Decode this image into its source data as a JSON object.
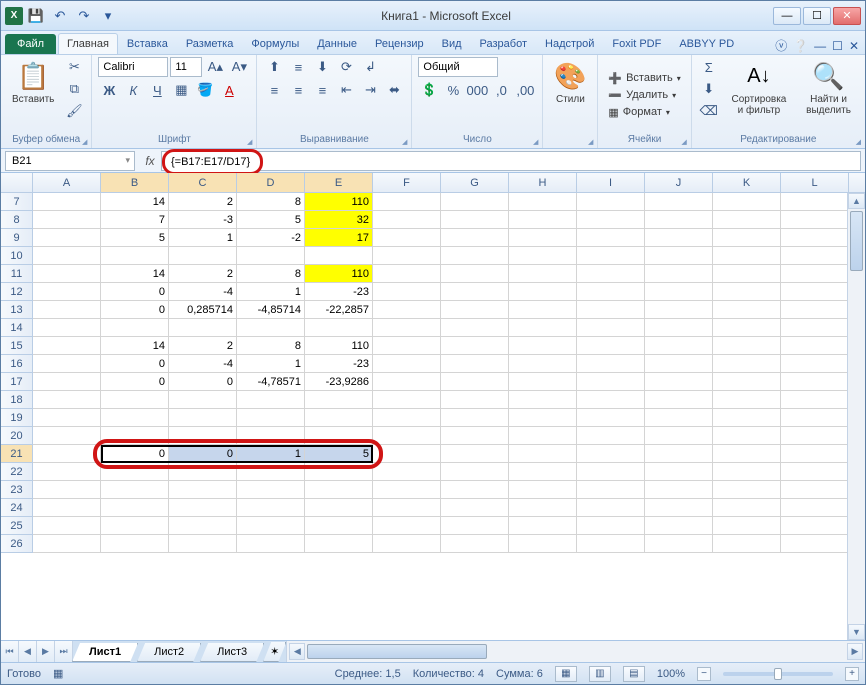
{
  "title": "Книга1  -  Microsoft Excel",
  "qat": {
    "save": "💾",
    "undo": "↶",
    "redo": "↷"
  },
  "tabs": {
    "file": "Файл",
    "items": [
      "Главная",
      "Вставка",
      "Разметка",
      "Формулы",
      "Данные",
      "Рецензир",
      "Вид",
      "Разработ",
      "Надстрой",
      "Foxit PDF",
      "ABBYY PD"
    ],
    "active": 0
  },
  "ribbon": {
    "clipboard": {
      "paste": "Вставить",
      "label": "Буфер обмена"
    },
    "font": {
      "name": "Calibri",
      "size": "11",
      "label": "Шрифт"
    },
    "align": {
      "label": "Выравнивание"
    },
    "number": {
      "format": "Общий",
      "label": "Число"
    },
    "styles": {
      "btn": "Стили",
      "label": ""
    },
    "cells": {
      "insert": "Вставить",
      "delete": "Удалить",
      "format": "Формат",
      "label": "Ячейки"
    },
    "editing": {
      "sort": "Сортировка и фильтр",
      "find": "Найти и выделить",
      "label": "Редактирование"
    }
  },
  "namebox": "B21",
  "formula": "{=B17:E17/D17}",
  "columns": [
    "A",
    "B",
    "C",
    "D",
    "E",
    "F",
    "G",
    "H",
    "I",
    "J",
    "K",
    "L"
  ],
  "sel_cols": [
    "B",
    "C",
    "D",
    "E"
  ],
  "rows": [
    {
      "n": 7,
      "c": {
        "B": "14",
        "C": "2",
        "D": "8",
        "E": "110"
      },
      "y": [
        "E"
      ]
    },
    {
      "n": 8,
      "c": {
        "B": "7",
        "C": "-3",
        "D": "5",
        "E": "32"
      },
      "y": [
        "E"
      ]
    },
    {
      "n": 9,
      "c": {
        "B": "5",
        "C": "1",
        "D": "-2",
        "E": "17"
      },
      "y": [
        "E"
      ]
    },
    {
      "n": 10,
      "c": {}
    },
    {
      "n": 11,
      "c": {
        "B": "14",
        "C": "2",
        "D": "8",
        "E": "110"
      },
      "y": [
        "E"
      ]
    },
    {
      "n": 12,
      "c": {
        "B": "0",
        "C": "-4",
        "D": "1",
        "E": "-23"
      }
    },
    {
      "n": 13,
      "c": {
        "B": "0",
        "C": "0,285714",
        "D": "-4,85714",
        "E": "-22,2857"
      }
    },
    {
      "n": 14,
      "c": {}
    },
    {
      "n": 15,
      "c": {
        "B": "14",
        "C": "2",
        "D": "8",
        "E": "110"
      }
    },
    {
      "n": 16,
      "c": {
        "B": "0",
        "C": "-4",
        "D": "1",
        "E": "-23"
      }
    },
    {
      "n": 17,
      "c": {
        "B": "0",
        "C": "0",
        "D": "-4,78571",
        "E": "-23,9286"
      }
    },
    {
      "n": 18,
      "c": {}
    },
    {
      "n": 19,
      "c": {}
    },
    {
      "n": 20,
      "c": {}
    },
    {
      "n": 21,
      "c": {
        "B": "0",
        "C": "0",
        "D": "1",
        "E": "5"
      },
      "sel": true
    },
    {
      "n": 22,
      "c": {}
    },
    {
      "n": 23,
      "c": {}
    },
    {
      "n": 24,
      "c": {}
    },
    {
      "n": 25,
      "c": {}
    },
    {
      "n": 26,
      "c": {}
    }
  ],
  "sheets": {
    "items": [
      "Лист1",
      "Лист2",
      "Лист3"
    ],
    "active": 0
  },
  "status": {
    "ready": "Готово",
    "avg_label": "Среднее:",
    "avg": "1,5",
    "count_label": "Количество:",
    "count": "4",
    "sum_label": "Сумма:",
    "sum": "6",
    "zoom": "100%"
  }
}
